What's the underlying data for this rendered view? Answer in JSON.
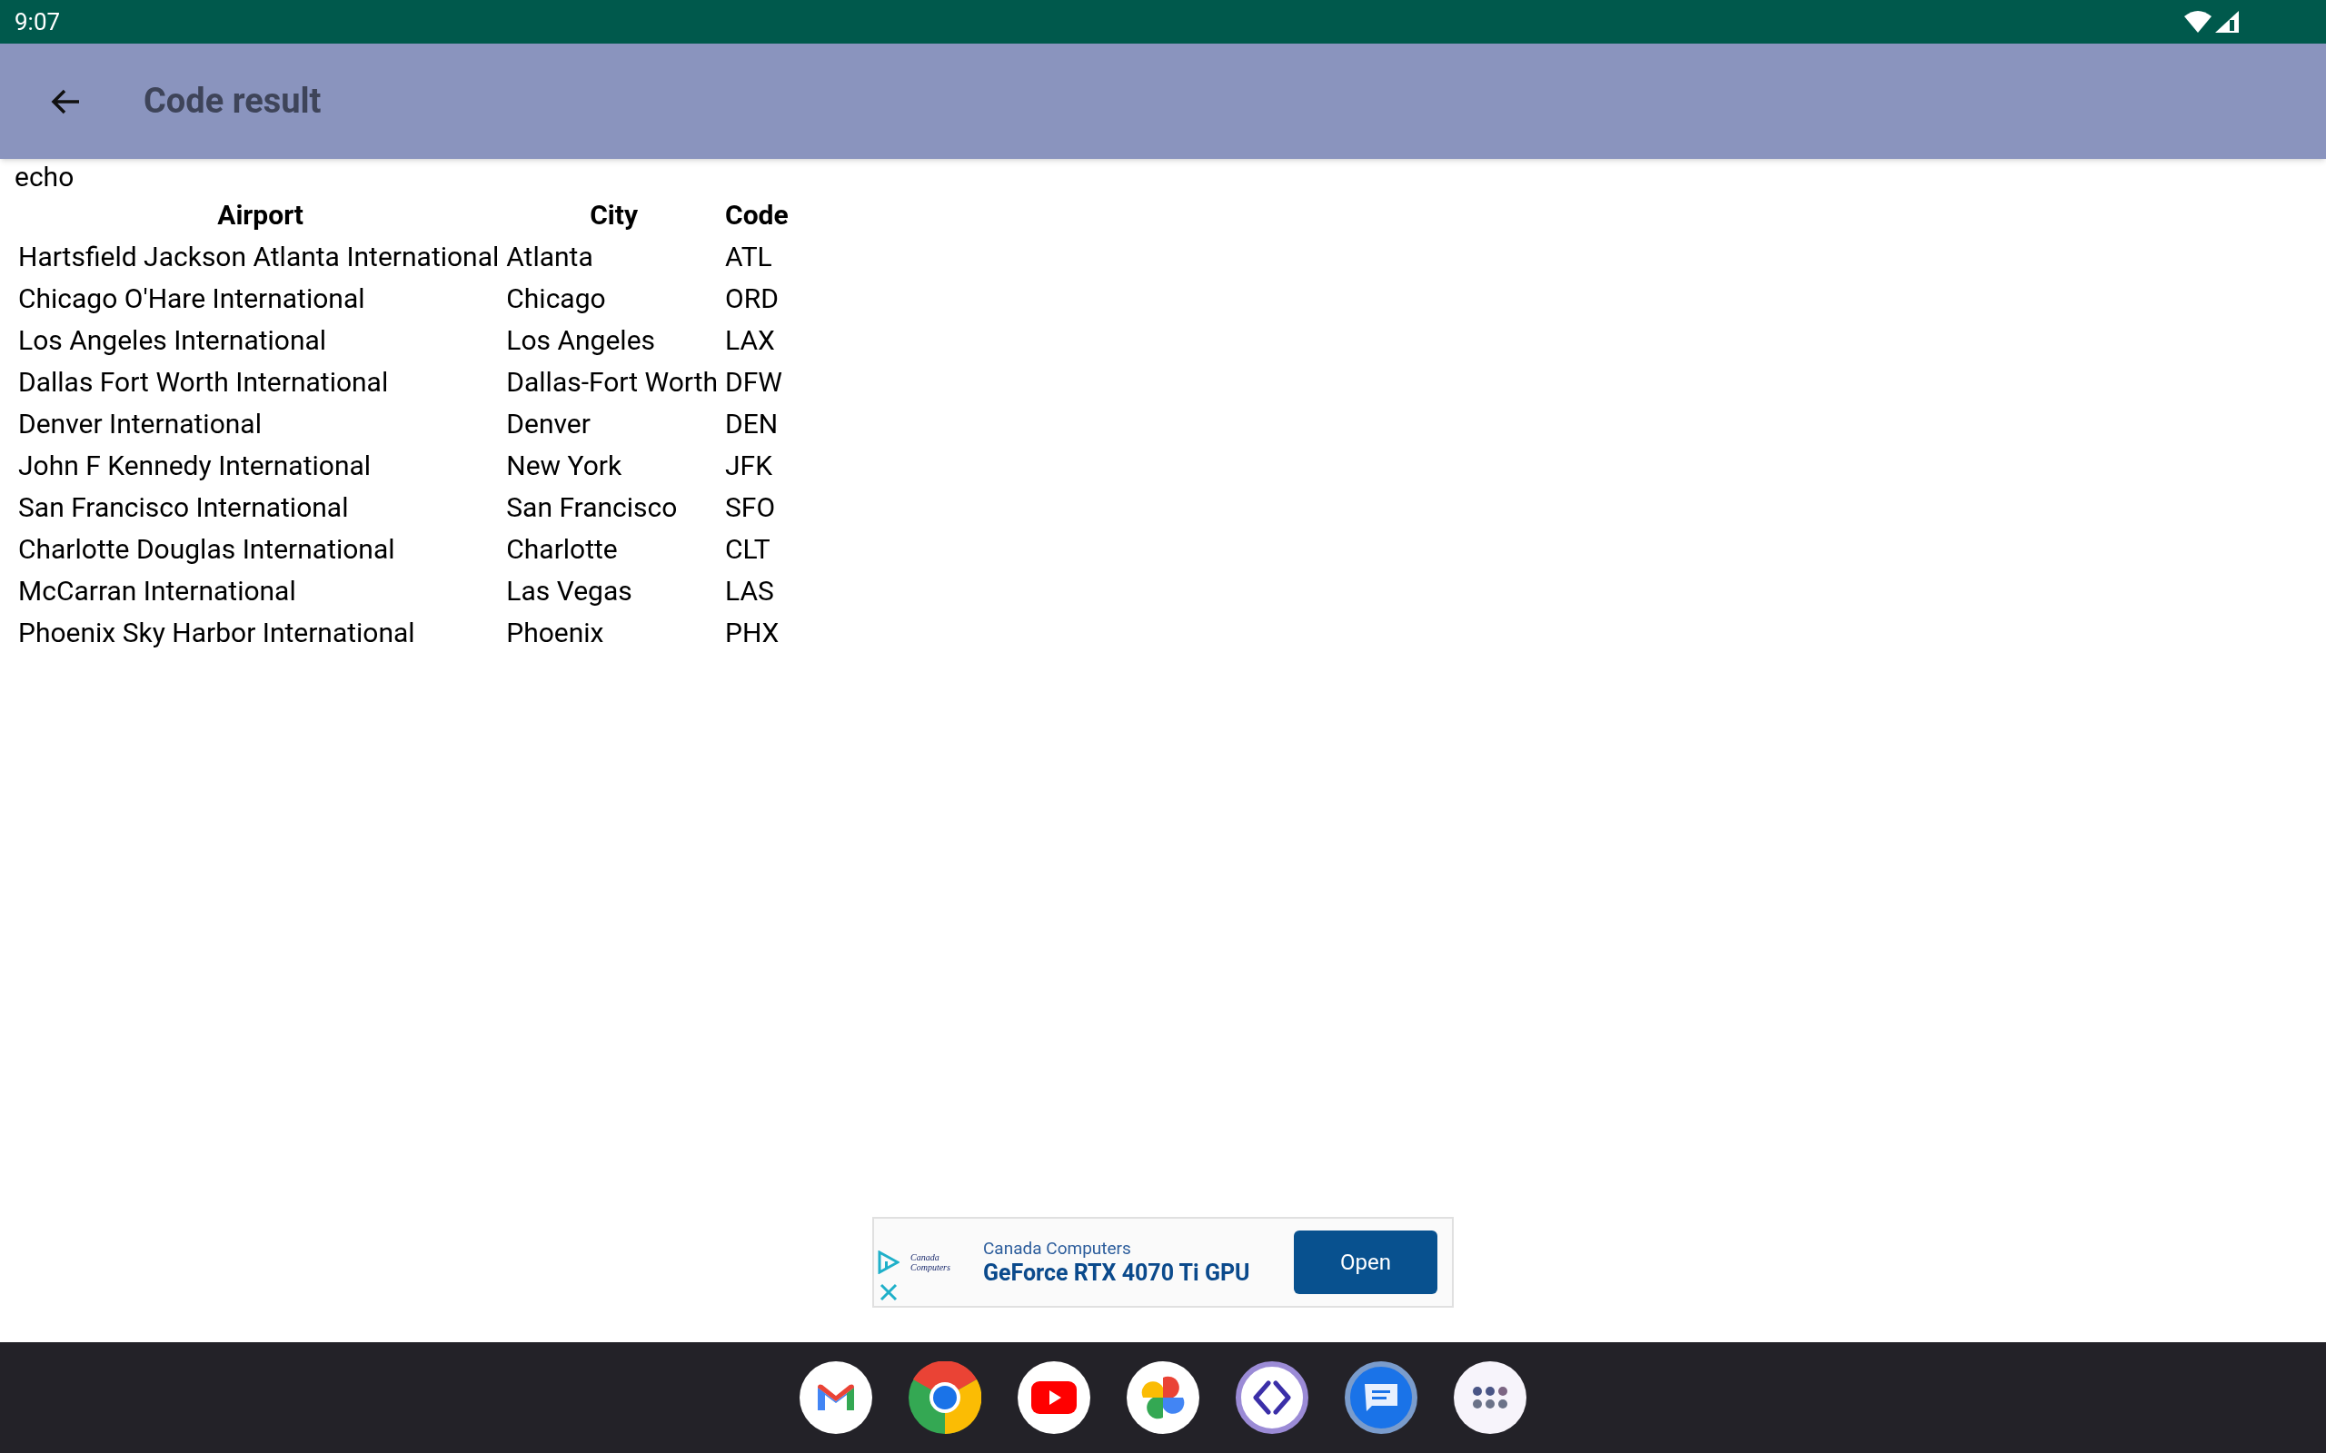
{
  "status_bar": {
    "time": "9:07"
  },
  "app_bar": {
    "title": "Code result"
  },
  "output_label": "echo",
  "table": {
    "columns": [
      "Airport",
      "City",
      "Code"
    ],
    "rows": [
      [
        "Hartsfield Jackson Atlanta International",
        "Atlanta",
        "ATL"
      ],
      [
        "Chicago O'Hare International",
        "Chicago",
        "ORD"
      ],
      [
        "Los Angeles International",
        "Los Angeles",
        "LAX"
      ],
      [
        "Dallas Fort Worth International",
        "Dallas-Fort Worth",
        "DFW"
      ],
      [
        "Denver International",
        "Denver",
        "DEN"
      ],
      [
        "John F Kennedy International",
        "New York",
        "JFK"
      ],
      [
        "San Francisco International",
        "San Francisco",
        "SFO"
      ],
      [
        "Charlotte Douglas International",
        "Charlotte",
        "CLT"
      ],
      [
        "McCarran International",
        "Las Vegas",
        "LAS"
      ],
      [
        "Phoenix Sky Harbor International",
        "Phoenix",
        "PHX"
      ]
    ]
  },
  "ad": {
    "logo_text": "Canada Computers",
    "advertiser": "Canada Computers",
    "headline": "GeForce RTX 4070 Ti GPU",
    "button": "Open"
  },
  "dock": [
    {
      "kind": "mail"
    },
    {
      "kind": "browser"
    },
    {
      "kind": "video"
    },
    {
      "kind": "photos"
    },
    {
      "kind": "code"
    },
    {
      "kind": "messages"
    },
    {
      "kind": "apps"
    }
  ]
}
